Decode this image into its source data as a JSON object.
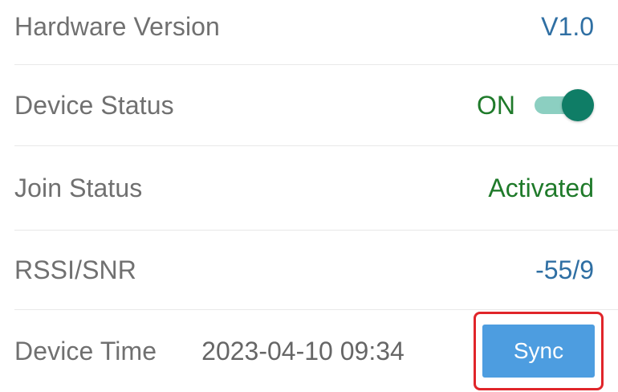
{
  "rows": {
    "hardware": {
      "label": "Hardware Version",
      "value": "V1.0"
    },
    "device_status": {
      "label": "Device Status",
      "value": "ON",
      "toggle_on": true
    },
    "join_status": {
      "label": "Join Status",
      "value": "Activated"
    },
    "rssi": {
      "label": "RSSI/SNR",
      "value": "-55/9"
    },
    "device_time": {
      "label": "Device Time",
      "value": "2023-04-10 09:34",
      "sync_label": "Sync"
    }
  },
  "colors": {
    "label_gray": "#707070",
    "value_blue": "#2f6fa3",
    "value_green": "#1f7a2a",
    "toggle_track": "#8ccfc1",
    "toggle_knob": "#0f7d66",
    "sync_button": "#4d9de0",
    "highlight_red": "#e0252a"
  }
}
